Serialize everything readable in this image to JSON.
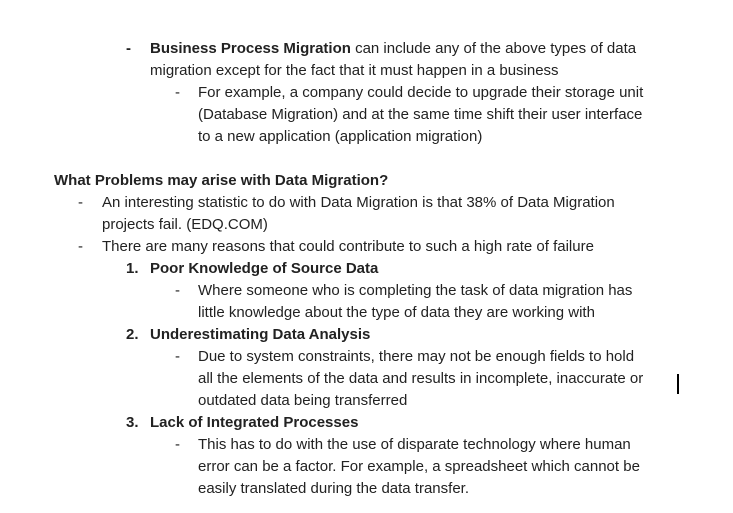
{
  "business_process": {
    "bullet": "-",
    "title": "Business Process Migration",
    "text_1": " can include any of the above types of data",
    "text_2": "migration except for the fact that it must happen in a business",
    "sub": {
      "bullet": "-",
      "lines": [
        "For example, a company could decide to upgrade their storage unit",
        "(Database Migration) and at the same time shift their user interface",
        "to a new application (application migration)"
      ]
    }
  },
  "problems": {
    "heading": "What Problems may arise with Data Migration?",
    "bullet_1": {
      "marker": "-",
      "lines": [
        "An interesting statistic to do with Data Migration is that 38% of Data Migration",
        "projects fail. (EDQ.COM)"
      ]
    },
    "bullet_2": {
      "marker": "-",
      "text": "There are many reasons that could contribute to such a high rate of failure"
    },
    "items": [
      {
        "number": "1.",
        "title": "Poor Knowledge of Source Data",
        "marker": "-",
        "lines": [
          "Where someone who is completing the task of data migration has",
          "little knowledge about the type of data they are working with"
        ]
      },
      {
        "number": "2.",
        "title": "Underestimating Data Analysis",
        "marker": "-",
        "lines": [
          "Due to system constraints, there may not be enough fields to hold",
          "all the elements of the data and results in incomplete, inaccurate or",
          "outdated data being transferred"
        ]
      },
      {
        "number": "3.",
        "title": "Lack of Integrated Processes",
        "marker": "-",
        "lines": [
          "This has to do with the use of disparate technology where human",
          "error can be a factor. For example, a spreadsheet which cannot be",
          "easily translated during the data transfer."
        ]
      }
    ]
  }
}
